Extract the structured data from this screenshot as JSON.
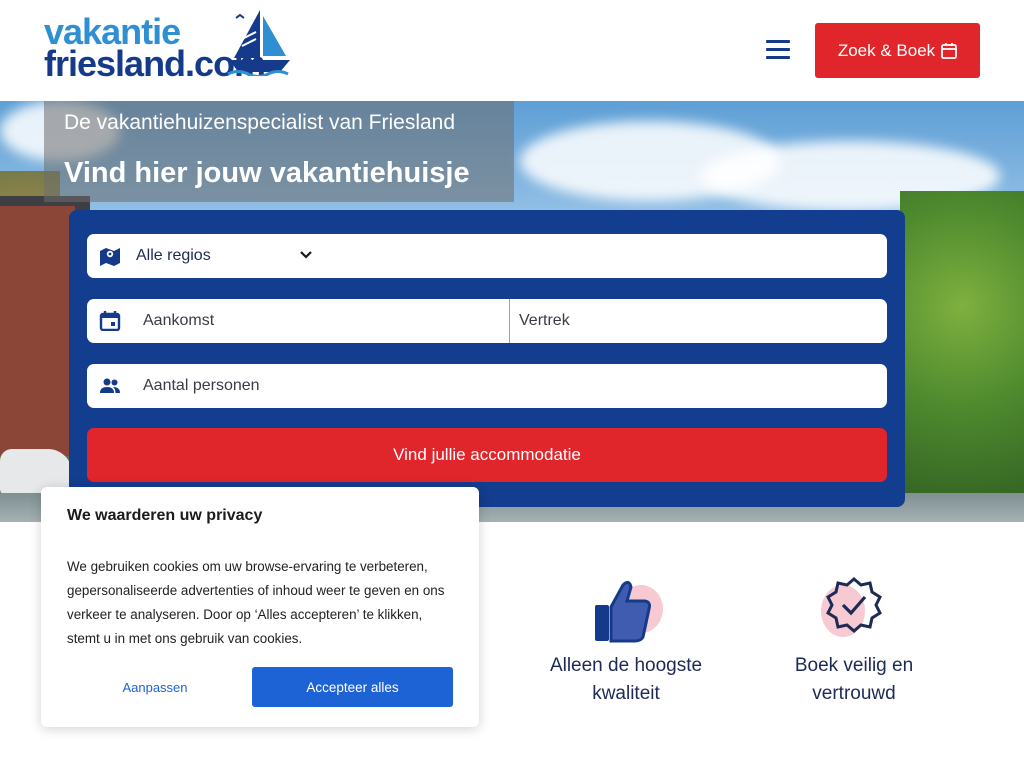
{
  "brand": {
    "line1": "vakantie",
    "line2": "friesland.com",
    "colors": {
      "light_blue": "#2e8fd3",
      "dark_blue": "#163a8a",
      "red": "#e0252b"
    }
  },
  "header": {
    "menu_icon": "hamburger-icon",
    "book_button": {
      "label": "Zoek & Boek",
      "icon": "calendar-icon"
    }
  },
  "hero": {
    "subtitle": "De vakantiehuizenspecialist van Friesland",
    "title": "Vind hier jouw vakantiehuisje"
  },
  "search": {
    "region": {
      "value": "Alle regios",
      "icon": "map-pin-icon"
    },
    "arrival": {
      "placeholder": "Aankomst",
      "icon": "calendar-icon"
    },
    "departure": {
      "placeholder": "Vertrek"
    },
    "persons": {
      "placeholder": "Aantal personen",
      "icon": "people-icon"
    },
    "submit_label": "Vind jullie accommodatie"
  },
  "features": [
    {
      "line1": "Alleen de hoogste",
      "line2": "kwaliteit",
      "icon": "thumbs-up-icon"
    },
    {
      "line1": "Boek veilig en",
      "line2": "vertrouwd",
      "icon": "verified-badge-icon"
    }
  ],
  "cookie": {
    "title": "We waarderen uw privacy",
    "text": "We gebruiken cookies om uw browse-ervaring te verbeteren, gepersonaliseerde advertenties of inhoud weer te geven en ons verkeer te analyseren. Door op ‘Alles accepteren’ te klikken, stemt u in met ons gebruik van cookies.",
    "customize_label": "Aanpassen",
    "accept_label": "Accepteer alles"
  }
}
